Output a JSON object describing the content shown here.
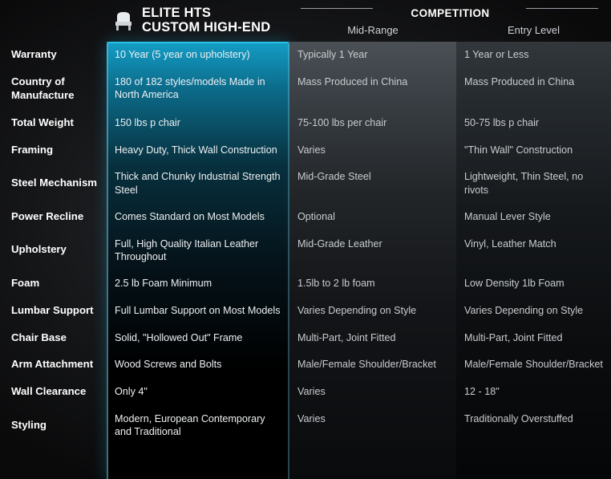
{
  "header": {
    "elite_title_line1": "ELITE HTS",
    "elite_title_line2": "CUSTOM HIGH-END",
    "competition_title": "COMPETITION",
    "mid_range_label": "Mid-Range",
    "entry_level_label": "Entry Level",
    "chair_icon": "chair-icon"
  },
  "columns": [
    "",
    "ELITE HTS CUSTOM HIGH-END",
    "Mid-Range",
    "Entry Level"
  ],
  "rows": [
    {
      "label": "Warranty",
      "elite": "10 Year (5 year on upholstery)",
      "mid": "Typically 1 Year",
      "entry": "1 Year or Less"
    },
    {
      "label": "Country of Manufacture",
      "elite": "180 of 182 styles/models Made in North America",
      "mid": "Mass Produced in China",
      "entry": "Mass Produced in China"
    },
    {
      "label": "Total Weight",
      "elite": "150 lbs p chair",
      "mid": "75-100 lbs per chair",
      "entry": "50-75 lbs p chair"
    },
    {
      "label": "Framing",
      "elite": "Heavy Duty, Thick Wall Construction",
      "mid": "Varies",
      "entry": "\"Thin Wall\" Construction"
    },
    {
      "label": "Steel Mechanism",
      "elite": "Thick and Chunky Industrial Strength Steel",
      "mid": "Mid-Grade Steel",
      "entry": "Lightweight, Thin Steel, no rivots"
    },
    {
      "label": "Power Recline",
      "elite": "Comes Standard on Most Models",
      "mid": "Optional",
      "entry": "Manual Lever Style"
    },
    {
      "label": "Upholstery",
      "elite": "Full, High Quality Italian Leather Throughout",
      "mid": "Mid-Grade Leather",
      "entry": "Vinyl, Leather Match"
    },
    {
      "label": "Foam",
      "elite": "2.5 lb Foam Minimum",
      "mid": "1.5lb to 2 lb foam",
      "entry": "Low Density 1lb Foam"
    },
    {
      "label": "Lumbar Support",
      "elite": "Full Lumbar Support on Most Models",
      "mid": "Varies Depending on Style",
      "entry": "Varies Depending on Style"
    },
    {
      "label": "Chair Base",
      "elite": "Solid, \"Hollowed Out\" Frame",
      "mid": "Multi-Part, Joint Fitted",
      "entry": "Multi-Part, Joint Fitted"
    },
    {
      "label": "Arm Attachment",
      "elite": "Wood Screws and Bolts",
      "mid": "Male/Female Shoulder/Bracket",
      "entry": "Male/Female Shoulder/Bracket"
    },
    {
      "label": "Wall Clearance",
      "elite": "Only 4\"",
      "mid": "Varies",
      "entry": "12 - 18\""
    },
    {
      "label": "Styling",
      "elite": "Modern, European Contemporary and Traditional",
      "mid": "Varies",
      "entry": "Traditionally Overstuffed"
    }
  ],
  "colors": {
    "elite_accent": "#27c2e8",
    "background": "#0d0d0f",
    "text": "#ffffff",
    "muted_text": "#c9ccd0"
  }
}
